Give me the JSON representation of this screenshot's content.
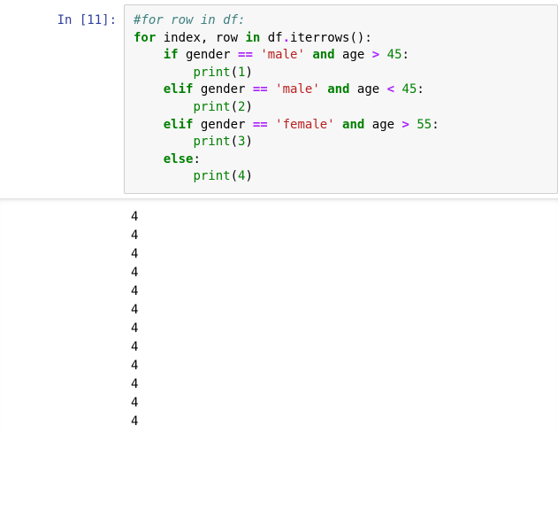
{
  "cell": {
    "prompt": "In [11]:",
    "code_lines": [
      [
        {
          "t": "#for row in df:",
          "c": "c-comment"
        }
      ],
      [
        {
          "t": "for",
          "c": "c-keyword"
        },
        {
          "t": " index, row "
        },
        {
          "t": "in",
          "c": "c-keyword"
        },
        {
          "t": " df"
        },
        {
          "t": ".",
          "c": "c-op"
        },
        {
          "t": "iterrows():"
        }
      ],
      [
        {
          "t": "    "
        },
        {
          "t": "if",
          "c": "c-keyword"
        },
        {
          "t": " gender "
        },
        {
          "t": "==",
          "c": "c-op"
        },
        {
          "t": " "
        },
        {
          "t": "'male'",
          "c": "c-string"
        },
        {
          "t": " "
        },
        {
          "t": "and",
          "c": "c-keyword"
        },
        {
          "t": " age "
        },
        {
          "t": ">",
          "c": "c-op"
        },
        {
          "t": " "
        },
        {
          "t": "45",
          "c": "c-number"
        },
        {
          "t": ":"
        }
      ],
      [
        {
          "t": "        "
        },
        {
          "t": "print",
          "c": "c-builtin"
        },
        {
          "t": "("
        },
        {
          "t": "1",
          "c": "c-number"
        },
        {
          "t": ")"
        }
      ],
      [
        {
          "t": "    "
        },
        {
          "t": "elif",
          "c": "c-keyword"
        },
        {
          "t": " gender "
        },
        {
          "t": "==",
          "c": "c-op"
        },
        {
          "t": " "
        },
        {
          "t": "'male'",
          "c": "c-string"
        },
        {
          "t": " "
        },
        {
          "t": "and",
          "c": "c-keyword"
        },
        {
          "t": " age "
        },
        {
          "t": "<",
          "c": "c-op"
        },
        {
          "t": " "
        },
        {
          "t": "45",
          "c": "c-number"
        },
        {
          "t": ":"
        }
      ],
      [
        {
          "t": "        "
        },
        {
          "t": "print",
          "c": "c-builtin"
        },
        {
          "t": "("
        },
        {
          "t": "2",
          "c": "c-number"
        },
        {
          "t": ")"
        }
      ],
      [
        {
          "t": "    "
        },
        {
          "t": "elif",
          "c": "c-keyword"
        },
        {
          "t": " gender "
        },
        {
          "t": "==",
          "c": "c-op"
        },
        {
          "t": " "
        },
        {
          "t": "'female'",
          "c": "c-string"
        },
        {
          "t": " "
        },
        {
          "t": "and",
          "c": "c-keyword"
        },
        {
          "t": " age "
        },
        {
          "t": ">",
          "c": "c-op"
        },
        {
          "t": " "
        },
        {
          "t": "55",
          "c": "c-number"
        },
        {
          "t": ":"
        }
      ],
      [
        {
          "t": "        "
        },
        {
          "t": "print",
          "c": "c-builtin"
        },
        {
          "t": "("
        },
        {
          "t": "3",
          "c": "c-number"
        },
        {
          "t": ")"
        }
      ],
      [
        {
          "t": "    "
        },
        {
          "t": "else",
          "c": "c-keyword"
        },
        {
          "t": ":"
        }
      ],
      [
        {
          "t": "        "
        },
        {
          "t": "print",
          "c": "c-builtin"
        },
        {
          "t": "("
        },
        {
          "t": "4",
          "c": "c-number"
        },
        {
          "t": ")"
        }
      ]
    ],
    "output_lines": [
      "4",
      "4",
      "4",
      "4",
      "4",
      "4",
      "4",
      "4",
      "4",
      "4",
      "4",
      "4"
    ]
  }
}
